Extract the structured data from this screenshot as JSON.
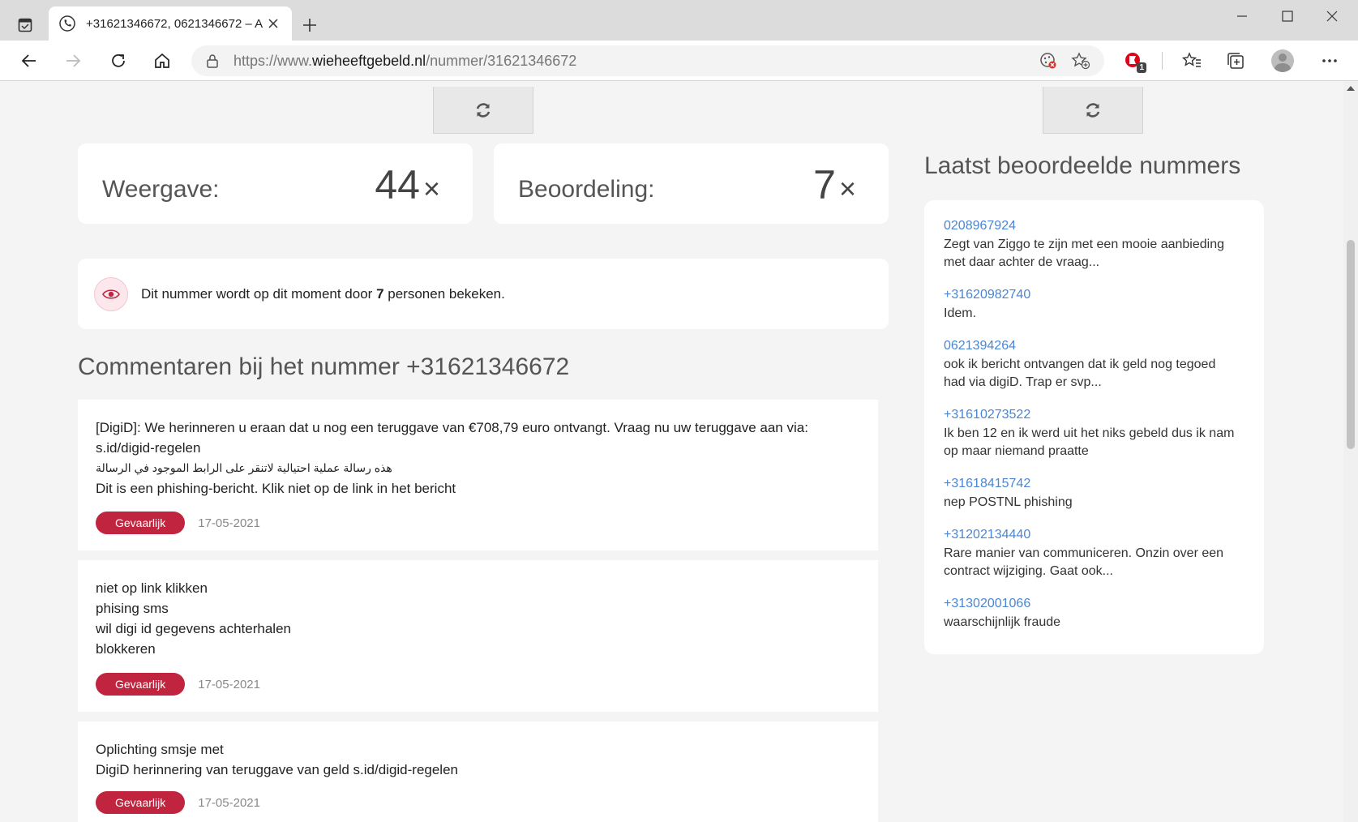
{
  "browser": {
    "tab_title": "+31621346672, 0621346672 – A",
    "url_prefix": "https://www.",
    "url_domain": "wieheeftgebeld.nl",
    "url_path": "/nummer/31621346672",
    "extension_badge": "1"
  },
  "stats": {
    "views_label": "Weergave:",
    "views_value": "44",
    "ratings_label": "Beoordeling:",
    "ratings_value": "7",
    "suffix": "×"
  },
  "viewers": {
    "text_before": "Dit nummer wordt op dit moment door ",
    "count": "7",
    "text_after": " personen bekeken."
  },
  "comments_title": "Commentaren bij het nummer +31621346672",
  "comments": [
    {
      "lines": [
        "[DigiD]: We herinneren u eraan dat u nog een teruggave van €708,79 euro ontvangt. Vraag nu uw teruggave aan via:",
        "s.id/digid-regelen",
        "هذه رسالة عملية احتيالية لاتنقر على الرابط الموجود في الرسالة",
        "Dit is een phishing-bericht. Klik niet op de link in het bericht"
      ],
      "badge": "Gevaarlijk",
      "date": "17-05-2021"
    },
    {
      "lines": [
        "niet op link klikken",
        "phising sms",
        "wil digi id gegevens achterhalen",
        "blokkeren"
      ],
      "badge": "Gevaarlijk",
      "date": "17-05-2021"
    },
    {
      "lines": [
        "Oplichting smsje met",
        "DigiD herinnering van teruggave van geld s.id/digid-regelen"
      ],
      "badge": "Gevaarlijk",
      "date": "17-05-2021"
    }
  ],
  "sidebar": {
    "title": "Laatst beoordeelde nummers",
    "items": [
      {
        "number": "0208967924",
        "desc1": "Zegt van Ziggo te zijn met een mooie aanbieding",
        "desc2": "met daar achter de vraag..."
      },
      {
        "number": "+31620982740",
        "desc1": "Idem.",
        "desc2": ""
      },
      {
        "number": "0621394264",
        "desc1": "ook ik bericht ontvangen dat ik geld nog tegoed",
        "desc2": "had via digiD. Trap er svp..."
      },
      {
        "number": "+31610273522",
        "desc1": "Ik ben 12 en ik werd uit het niks gebeld dus ik nam",
        "desc2": "op maar niemand praatte"
      },
      {
        "number": "+31618415742",
        "desc1": "nep POSTNL phishing",
        "desc2": ""
      },
      {
        "number": "+31202134440",
        "desc1": "Rare manier van communiceren. Onzin over een",
        "desc2": "contract wijziging. Gaat ook..."
      },
      {
        "number": "+31302001066",
        "desc1": "waarschijnlijk fraude",
        "desc2": ""
      }
    ]
  },
  "colors": {
    "danger": "#c0243f",
    "link": "#4a86d4"
  }
}
